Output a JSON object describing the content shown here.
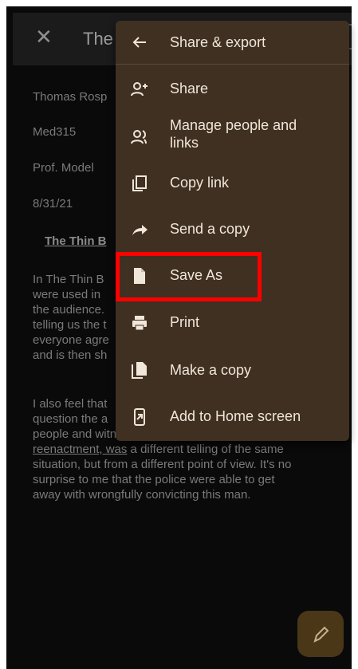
{
  "app": {
    "doc_title_visible": "The T",
    "doc_lines": {
      "author": "Thomas Rosp",
      "course": "Med315",
      "professor": "Prof. Model",
      "date": "8/31/21",
      "heading": "The Thin B"
    },
    "para1": [
      "In The Thin B",
      "were used in",
      "the audience.",
      "telling us the t",
      "everyone agre",
      "and is then sh"
    ],
    "para2_first": [
      "I also feel that",
      "question the a"
    ],
    "para2_visible": {
      "line3": "people and witnesses involved. Each",
      "line4_underlined": "reenactment, was",
      "line4_rest": " a different telling of the same",
      "line5": "situation, but from a different point of view. It's no",
      "line6": "surprise to me that the police were able to get",
      "line7": "away with wrongfully convicting this man."
    }
  },
  "menu": {
    "header": "Share & export",
    "items": [
      {
        "label": "Share",
        "icon": "person-add-icon"
      },
      {
        "label": "Manage people and links",
        "icon": "manage-people-icon"
      },
      {
        "label": "Copy link",
        "icon": "copy-link-icon"
      },
      {
        "label": "Send a copy",
        "icon": "send-arrow-icon"
      },
      {
        "label": "Save As",
        "icon": "file-icon"
      },
      {
        "label": "Print",
        "icon": "printer-icon"
      },
      {
        "label": "Make a copy",
        "icon": "copy-file-icon"
      },
      {
        "label": "Add to Home screen",
        "icon": "add-to-home-icon"
      }
    ]
  },
  "colors": {
    "menu_bg": "#3f3021",
    "highlight": "#ff0000",
    "fab_bg": "#4a3717"
  }
}
